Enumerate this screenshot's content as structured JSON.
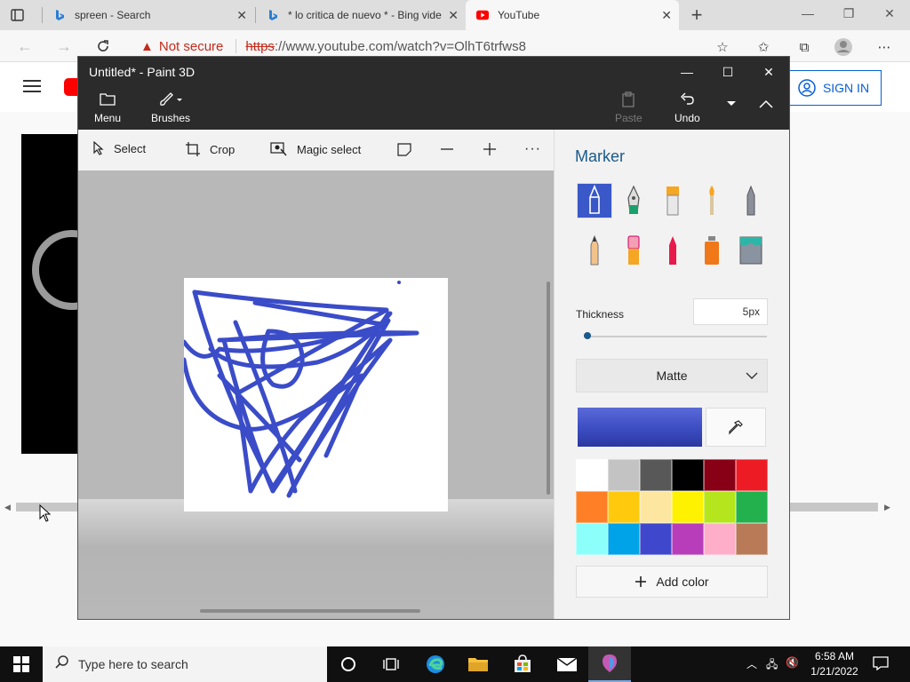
{
  "browser": {
    "tabs": [
      {
        "title": "spreen - Search",
        "active": false
      },
      {
        "title": "* lo critica de nuevo * - Bing vide",
        "active": false
      },
      {
        "title": "YouTube",
        "active": true
      }
    ],
    "security_label": "Not secure",
    "url_scheme": "https",
    "url_rest": "://www.youtube.com/watch?v=OlhT6trfws8"
  },
  "youtube": {
    "sign_in_label": "SIGN IN"
  },
  "paint": {
    "title": "Untitled* - Paint 3D",
    "ribbon": {
      "menu_label": "Menu",
      "brushes_label": "Brushes",
      "paste_label": "Paste",
      "undo_label": "Undo"
    },
    "toolbar": {
      "select_label": "Select",
      "crop_label": "Crop",
      "magic_select_label": "Magic select"
    },
    "panel": {
      "tool_title": "Marker",
      "thickness_label": "Thickness",
      "thickness_value": "5px",
      "thickness_fraction": 0.02,
      "finish_label": "Matte",
      "current_color": "#3e4fc4",
      "add_color_label": "Add color",
      "brushes": [
        "marker-icon",
        "calligraphy-pen-icon",
        "oil-brush-icon",
        "watercolor-icon",
        "pixel-pen-icon",
        "pencil-icon",
        "eraser-icon",
        "crayon-icon",
        "spray-can-icon",
        "fill-icon"
      ],
      "palette": [
        "#ffffff",
        "#c3c3c3",
        "#585858",
        "#000000",
        "#880015",
        "#ed1c24",
        "#ff7f27",
        "#ffc90e",
        "#fde7a0",
        "#fff200",
        "#b5e61d",
        "#22b14c",
        "#8cfffb",
        "#00a2e8",
        "#3f48cc",
        "#b83dba",
        "#ffaec9",
        "#b97a57"
      ]
    },
    "stroke_color": "#3a4cc8"
  },
  "taskbar": {
    "search_placeholder": "Type here to search",
    "time": "6:58 AM",
    "date": "1/21/2022"
  }
}
